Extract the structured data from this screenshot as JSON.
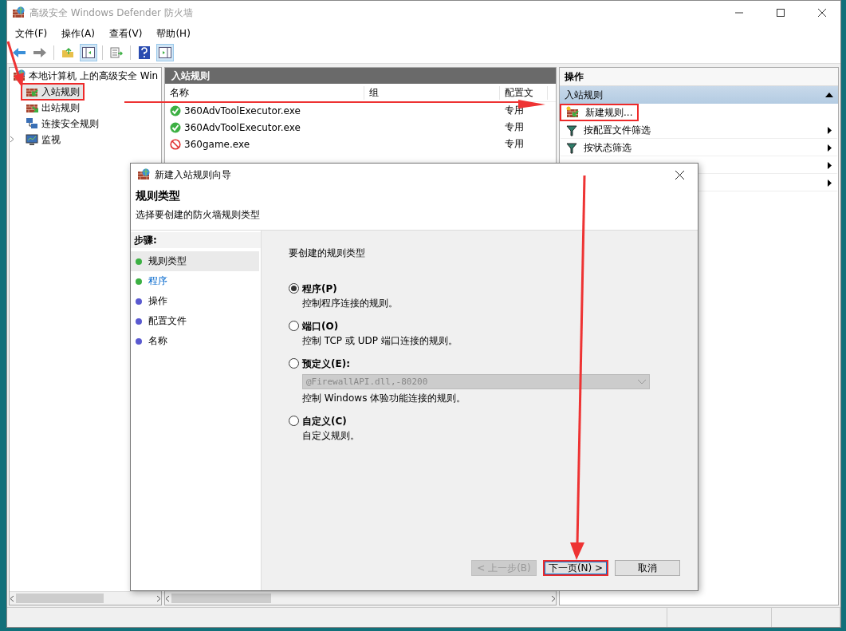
{
  "window": {
    "title": "高级安全 Windows Defender 防火墙"
  },
  "menu": [
    "文件(F)",
    "操作(A)",
    "查看(V)",
    "帮助(H)"
  ],
  "tree": {
    "root": "本地计算机 上的高级安全 Win",
    "children": [
      {
        "label": "入站规则",
        "kind": "inbound",
        "selected": true,
        "highlighted": true
      },
      {
        "label": "出站规则",
        "kind": "outbound",
        "selected": false,
        "highlighted": false
      },
      {
        "label": "连接安全规则",
        "kind": "network",
        "selected": false,
        "highlighted": false
      },
      {
        "label": "监视",
        "kind": "monitor",
        "selected": false,
        "highlighted": false,
        "expandable": true
      }
    ]
  },
  "rules": {
    "title": "入站规则",
    "columns": [
      "名称",
      "组",
      "配置文"
    ],
    "rows": [
      {
        "name": "360AdvToolExecutor.exe",
        "profile": "专用",
        "kind": "allow"
      },
      {
        "name": "360AdvToolExecutor.exe",
        "profile": "专用",
        "kind": "allow"
      },
      {
        "name": "360game.exe",
        "profile": "专用",
        "kind": "block"
      }
    ]
  },
  "actions": {
    "title": "操作",
    "section": "入站规则",
    "expanded": true,
    "items": [
      {
        "label": "新建规则...",
        "kind": "new-rule",
        "submenu": false,
        "highlighted": true
      },
      {
        "label": "按配置文件筛选",
        "kind": "filter",
        "submenu": true,
        "highlighted": false
      },
      {
        "label": "按状态筛选",
        "kind": "filter",
        "submenu": true,
        "highlighted": false
      },
      {
        "kind": "hidden",
        "submenu": true,
        "highlighted": false
      },
      {
        "kind": "hidden",
        "submenu": true,
        "highlighted": false
      }
    ]
  },
  "dialog": {
    "title": "新建入站规则向导",
    "heading": "规则类型",
    "subtitle": "选择要创建的防火墙规则类型",
    "steps_title": "步骤:",
    "steps": [
      {
        "label": "规则类型",
        "color": "#3cb043",
        "selected": true,
        "link": false
      },
      {
        "label": "程序",
        "color": "#3cb043",
        "selected": false,
        "link": true
      },
      {
        "label": "操作",
        "color": "#5a5ad0",
        "selected": false,
        "link": false
      },
      {
        "label": "配置文件",
        "color": "#5a5ad0",
        "selected": false,
        "link": false
      },
      {
        "label": "名称",
        "color": "#5a5ad0",
        "selected": false,
        "link": false
      }
    ],
    "prompt": "要创建的规则类型",
    "options": [
      {
        "label": "程序(P)",
        "description": "控制程序连接的规则。",
        "selected": true
      },
      {
        "label": "端口(O)",
        "description": "控制 TCP 或 UDP 端口连接的规则。",
        "selected": false
      },
      {
        "label": "预定义(E):",
        "combo": "@FirewallAPI.dll,-80200",
        "combo_disabled": true,
        "description": "控制 Windows 体验功能连接的规则。",
        "selected": false
      },
      {
        "label": "自定义(C)",
        "description": "自定义规则。",
        "selected": false
      }
    ],
    "buttons": [
      {
        "label": "< 上一步(B)",
        "disabled": true,
        "highlighted": false
      },
      {
        "label": "下一页(N) >",
        "disabled": false,
        "highlighted": true
      },
      {
        "label": "取消",
        "disabled": false,
        "highlighted": false
      }
    ]
  },
  "annotations": {
    "arrows": true
  }
}
